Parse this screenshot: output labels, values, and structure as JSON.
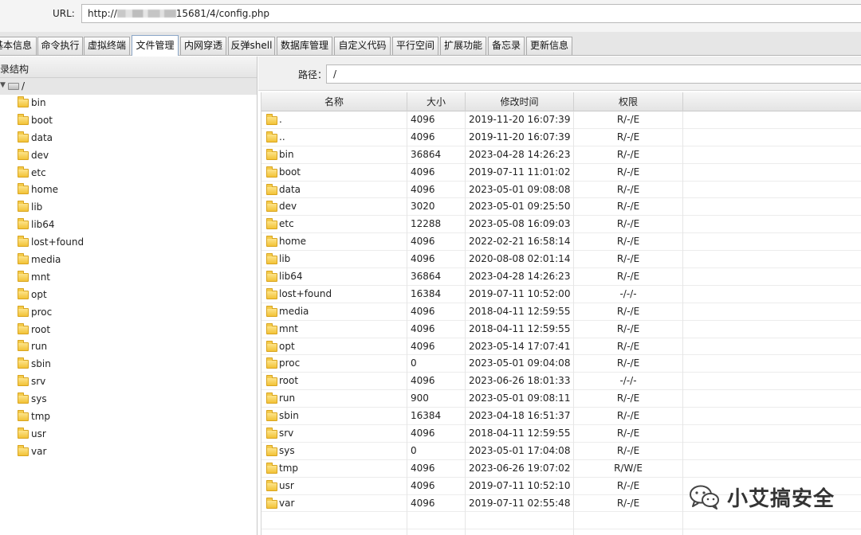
{
  "url_bar": {
    "label": "URL:",
    "url_prefix": "http://",
    "url_suffix": "15681/4/config.php"
  },
  "tabs": [
    {
      "label": "基本信息",
      "active": false
    },
    {
      "label": "命令执行",
      "active": false
    },
    {
      "label": "虚拟终端",
      "active": false
    },
    {
      "label": "文件管理",
      "active": true
    },
    {
      "label": "内网穿透",
      "active": false
    },
    {
      "label": "反弹shell",
      "active": false
    },
    {
      "label": "数据库管理",
      "active": false
    },
    {
      "label": "自定义代码",
      "active": false
    },
    {
      "label": "平行空间",
      "active": false
    },
    {
      "label": "扩展功能",
      "active": false
    },
    {
      "label": "备忘录",
      "active": false
    },
    {
      "label": "更新信息",
      "active": false
    }
  ],
  "tree": {
    "header": "目录结构",
    "root": "/",
    "items": [
      "bin",
      "boot",
      "data",
      "dev",
      "etc",
      "home",
      "lib",
      "lib64",
      "lost+found",
      "media",
      "mnt",
      "opt",
      "proc",
      "root",
      "run",
      "sbin",
      "srv",
      "sys",
      "tmp",
      "usr",
      "var"
    ]
  },
  "path": {
    "label": "路径：",
    "value": "/"
  },
  "table": {
    "headers": [
      "名称",
      "大小",
      "修改时间",
      "权限"
    ],
    "rows": [
      {
        "name": ".",
        "size": "4096",
        "time": "2019-11-20 16:07:39",
        "perm": "R/-/E"
      },
      {
        "name": "..",
        "size": "4096",
        "time": "2019-11-20 16:07:39",
        "perm": "R/-/E"
      },
      {
        "name": "bin",
        "size": "36864",
        "time": "2023-04-28 14:26:23",
        "perm": "R/-/E"
      },
      {
        "name": "boot",
        "size": "4096",
        "time": "2019-07-11 11:01:02",
        "perm": "R/-/E"
      },
      {
        "name": "data",
        "size": "4096",
        "time": "2023-05-01 09:08:08",
        "perm": "R/-/E"
      },
      {
        "name": "dev",
        "size": "3020",
        "time": "2023-05-01 09:25:50",
        "perm": "R/-/E"
      },
      {
        "name": "etc",
        "size": "12288",
        "time": "2023-05-08 16:09:03",
        "perm": "R/-/E"
      },
      {
        "name": "home",
        "size": "4096",
        "time": "2022-02-21 16:58:14",
        "perm": "R/-/E"
      },
      {
        "name": "lib",
        "size": "4096",
        "time": "2020-08-08 02:01:14",
        "perm": "R/-/E"
      },
      {
        "name": "lib64",
        "size": "36864",
        "time": "2023-04-28 14:26:23",
        "perm": "R/-/E"
      },
      {
        "name": "lost+found",
        "size": "16384",
        "time": "2019-07-11 10:52:00",
        "perm": "-/-/-"
      },
      {
        "name": "media",
        "size": "4096",
        "time": "2018-04-11 12:59:55",
        "perm": "R/-/E"
      },
      {
        "name": "mnt",
        "size": "4096",
        "time": "2018-04-11 12:59:55",
        "perm": "R/-/E"
      },
      {
        "name": "opt",
        "size": "4096",
        "time": "2023-05-14 17:07:41",
        "perm": "R/-/E"
      },
      {
        "name": "proc",
        "size": "0",
        "time": "2023-05-01 09:04:08",
        "perm": "R/-/E"
      },
      {
        "name": "root",
        "size": "4096",
        "time": "2023-06-26 18:01:33",
        "perm": "-/-/-"
      },
      {
        "name": "run",
        "size": "900",
        "time": "2023-05-01 09:08:11",
        "perm": "R/-/E"
      },
      {
        "name": "sbin",
        "size": "16384",
        "time": "2023-04-18 16:51:37",
        "perm": "R/-/E"
      },
      {
        "name": "srv",
        "size": "4096",
        "time": "2018-04-11 12:59:55",
        "perm": "R/-/E"
      },
      {
        "name": "sys",
        "size": "0",
        "time": "2023-05-01 17:04:08",
        "perm": "R/-/E"
      },
      {
        "name": "tmp",
        "size": "4096",
        "time": "2023-06-26 19:07:02",
        "perm": "R/W/E"
      },
      {
        "name": "usr",
        "size": "4096",
        "time": "2019-07-11 10:52:10",
        "perm": "R/-/E"
      },
      {
        "name": "var",
        "size": "4096",
        "time": "2019-07-11 02:55:48",
        "perm": "R/-/E"
      }
    ]
  },
  "watermark": {
    "text": "小艾搞安全",
    "icon": "wechat-icon"
  }
}
